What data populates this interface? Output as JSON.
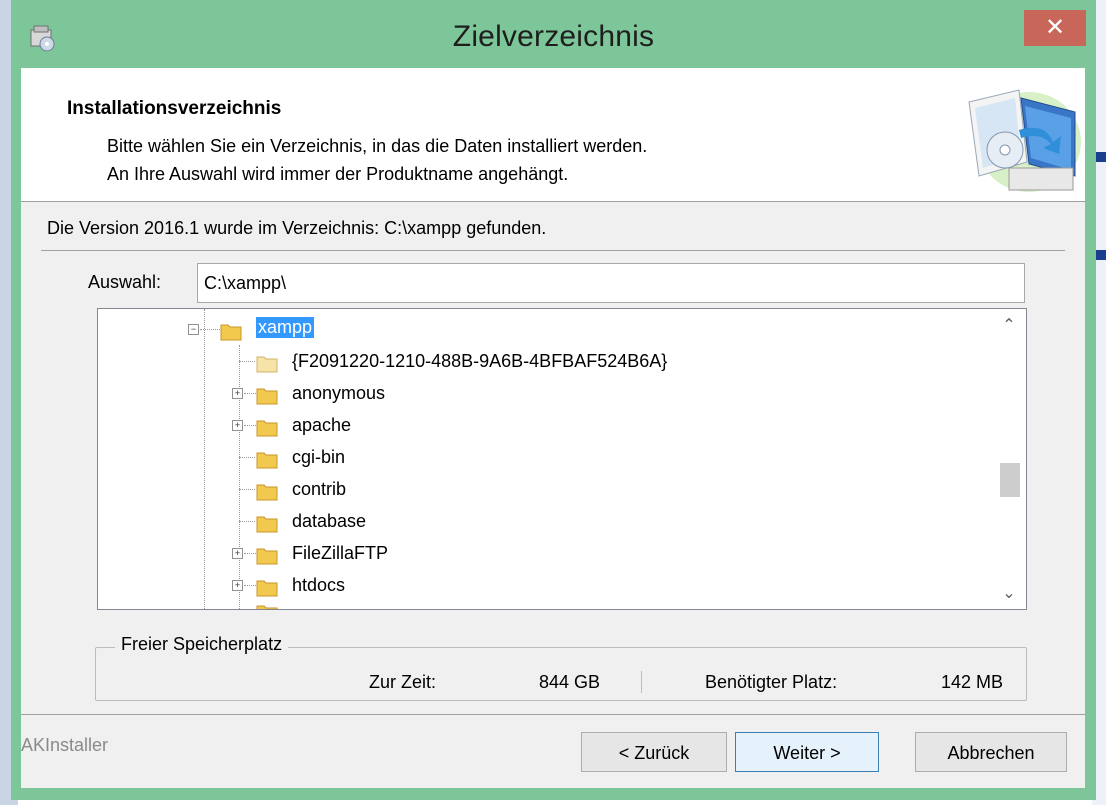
{
  "window": {
    "title": "Zielverzeichnis",
    "close_glyph": "✕",
    "app_icon": "installer-app-icon",
    "titlebar_color": "#7cc699",
    "close_color": "#c9665a"
  },
  "header": {
    "title": "Installationsverzeichnis",
    "desc_line1": "Bitte wählen Sie ein Verzeichnis, in das die Daten installiert werden.",
    "desc_line2": "An Ihre Auswahl wird immer der Produktname angehängt.",
    "image": "installer-computer-cd-icon"
  },
  "found_message": "Die Version 2016.1 wurde im Verzeichnis: C:\\xampp gefunden.",
  "selection": {
    "label": "Auswahl:",
    "value": "C:\\xampp\\"
  },
  "tree": {
    "items": [
      {
        "label": "xampp",
        "selected": true,
        "expander": "−"
      },
      {
        "label": "{F2091220-1210-488B-9A6B-4BFBAF524B6A}"
      },
      {
        "label": "anonymous",
        "expander": "+"
      },
      {
        "label": "apache",
        "expander": "+"
      },
      {
        "label": "cgi-bin"
      },
      {
        "label": "contrib"
      },
      {
        "label": "database"
      },
      {
        "label": "FileZillaFTP",
        "expander": "+"
      },
      {
        "label": "htdocs",
        "expander": "+"
      }
    ],
    "scroll_up_glyph": "⌃",
    "scroll_down_glyph": "⌄",
    "selection_color": "#3399ff"
  },
  "free_space": {
    "legend": "Freier Speicherplatz",
    "current_label": "Zur Zeit:",
    "current_value": "844 GB",
    "required_label": "Benötigter Platz:",
    "required_value": "142 MB"
  },
  "footer": {
    "brand": "AKInstaller",
    "back_label": "< Zurück",
    "next_label": "Weiter >",
    "cancel_label": "Abbrechen"
  }
}
